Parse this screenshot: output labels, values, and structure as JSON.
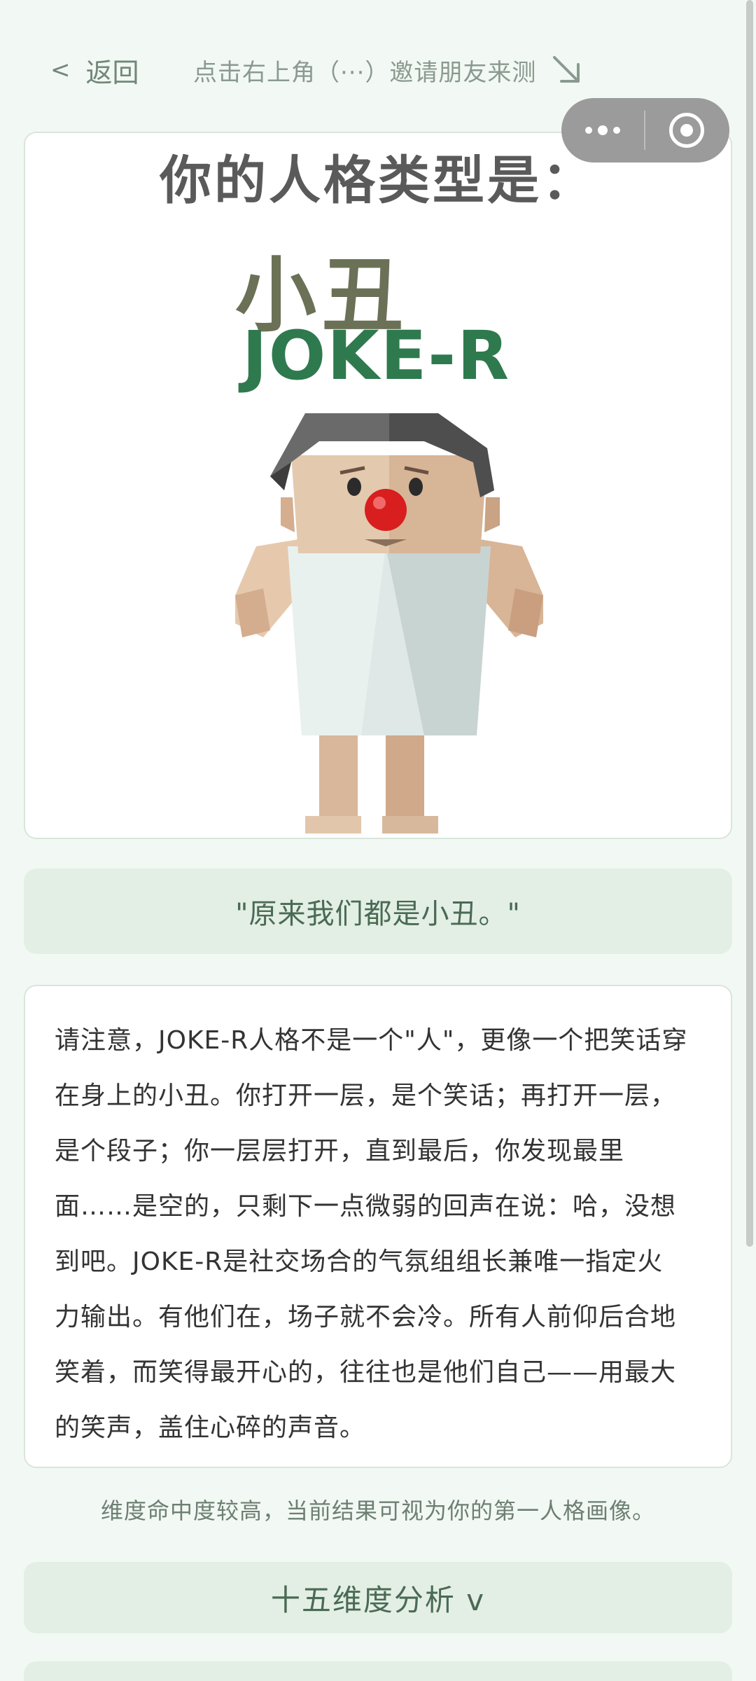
{
  "nav": {
    "back_label": "返回",
    "invite_hint": "点击右上角（···）邀请朋友来测"
  },
  "result": {
    "heading": "你的人格类型是：",
    "type_name": "小丑",
    "type_code": "JOKE-R"
  },
  "quote": "\"原来我们都是小丑。\"",
  "description": "请注意，JOKE-R人格不是一个\"人\"，更像一个把笑话穿在身上的小丑。你打开一层，是个笑话；再打开一层，是个段子；你一层层打开，直到最后，你发现最里面……是空的，只剩下一点微弱的回声在说：哈，没想到吧。JOKE-R是社交场合的气氛组组长兼唯一指定火力输出。有他们在，场子就不会冷。所有人前仰后合地笑着，而笑得最开心的，往往也是他们自己——用最大的笑声，盖住心碎的声音。",
  "confidence_note": "维度命中度较高，当前结果可视为你的第一人格画像。",
  "dimension_button": "十五维度分析 v",
  "icons": {
    "back": "chevron-left-icon",
    "invite": "arrow-down-right-icon",
    "more": "more-dots-icon",
    "close": "target-close-icon"
  },
  "colors": {
    "background": "#f2f8f3",
    "accent_light": "#e3efe5",
    "accent_text": "#4a6a54",
    "type_code": "#2e7a4e"
  }
}
